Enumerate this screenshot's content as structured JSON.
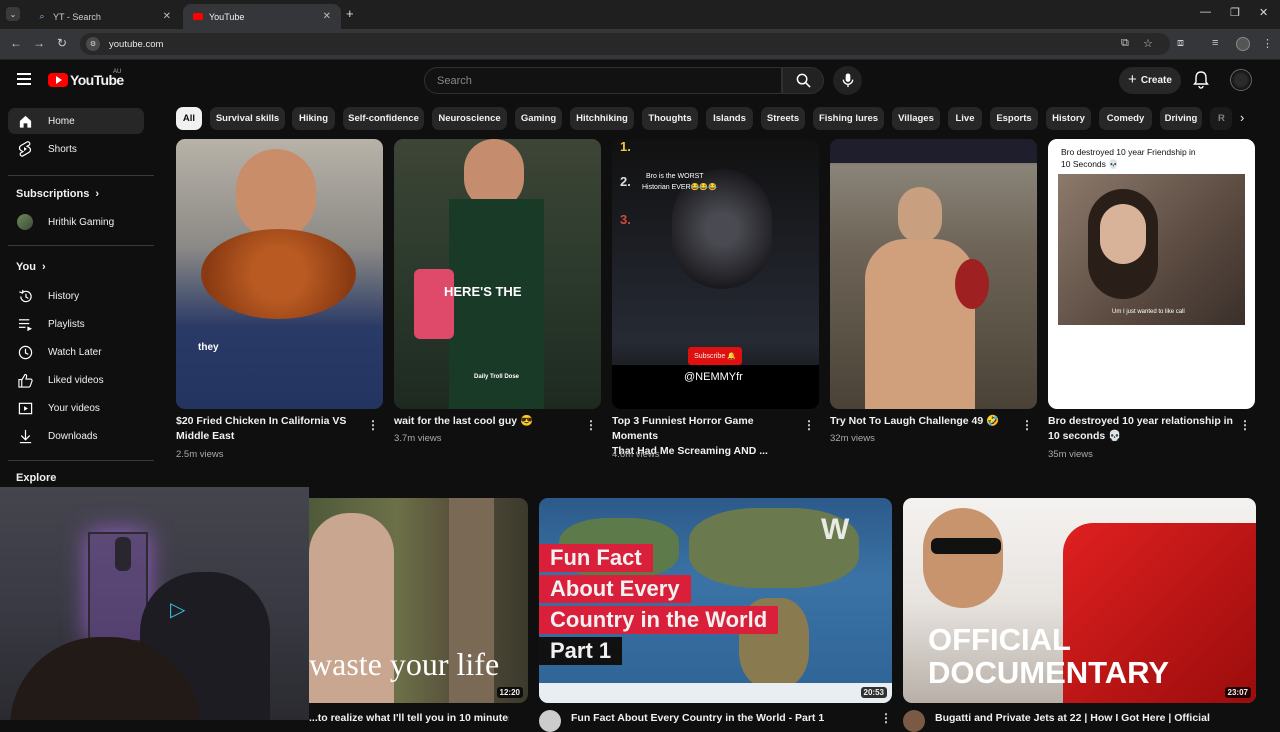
{
  "browser": {
    "tabs": [
      {
        "title": "YT - Search"
      },
      {
        "title": "YouTube"
      }
    ],
    "url": "youtube.com"
  },
  "header": {
    "logo_text": "YouTube",
    "region": "AU",
    "search_placeholder": "Search",
    "create_label": "Create"
  },
  "sidebar": {
    "main": [
      {
        "label": "Home",
        "icon": "home-icon"
      },
      {
        "label": "Shorts",
        "icon": "shorts-icon"
      }
    ],
    "subscriptions_heading": "Subscriptions",
    "subscriptions": [
      {
        "label": "Hrithik Gaming"
      }
    ],
    "you_heading": "You",
    "you_items": [
      {
        "label": "History",
        "icon": "history-icon"
      },
      {
        "label": "Playlists",
        "icon": "playlists-icon"
      },
      {
        "label": "Watch Later",
        "icon": "watch-later-icon"
      },
      {
        "label": "Liked videos",
        "icon": "like-icon"
      },
      {
        "label": "Your videos",
        "icon": "your-videos-icon"
      },
      {
        "label": "Downloads",
        "icon": "download-icon"
      }
    ],
    "explore_heading": "Explore"
  },
  "chips": [
    "All",
    "Survival skills",
    "Hiking",
    "Self-confidence",
    "Neuroscience",
    "Gaming",
    "Hitchhiking",
    "Thoughts",
    "Islands",
    "Streets",
    "Fishing lures",
    "Villages",
    "Live",
    "Esports",
    "History",
    "Comedy",
    "Driving",
    "R"
  ],
  "shorts": [
    {
      "title_line1": "$20 Fried Chicken In California VS",
      "title_line2": "Middle East",
      "views": "2.5m views",
      "overlay": "they"
    },
    {
      "title_line1": "wait for the last cool guy 😎",
      "title_line2": "",
      "views": "3.7m views",
      "overlay": "HERE'S THE",
      "overlay2": "Daily Troll Dose"
    },
    {
      "title_line1": "Top 3 Funniest Horror Game Moments",
      "title_line2": "That Had Me Screaming AND ...",
      "views": "4.6m views",
      "overlay": "@NEMMYfr",
      "rank1": "1.",
      "rank2": "2.",
      "rank3": "3.",
      "caption": "Bro is the WORST",
      "caption2": "Historian EVER😂😂😂",
      "sub_label": "Subscribe 🔔"
    },
    {
      "title_line1": "Try Not To Laugh Challenge 49 🤣",
      "title_line2": "",
      "views": "32m views"
    },
    {
      "title_line1": "Bro destroyed 10 year relationship in",
      "title_line2": "10 seconds 💀",
      "views": "35m views",
      "overlay": "Bro destroyed 10 year Friendship in",
      "overlay2": "10 Seconds 💀",
      "caption": "Um I just wanted to like call"
    }
  ],
  "videos": [
    {
      "duration": "12:20",
      "overlay": "waste your life",
      "title": "...to realize what I'll tell you in 10 minutes"
    },
    {
      "duration": "20:53",
      "overlay_lines": [
        "Fun Fact",
        "About Every",
        "Country in the World",
        "Part 1"
      ],
      "title": "Fun Fact About Every Country in the World - Part 1"
    },
    {
      "duration": "23:07",
      "overlay_lines": [
        "OFFICIAL",
        "DOCUMENTARY"
      ],
      "title": "Bugatti and Private Jets at 22 | How I Got Here | Official"
    }
  ]
}
